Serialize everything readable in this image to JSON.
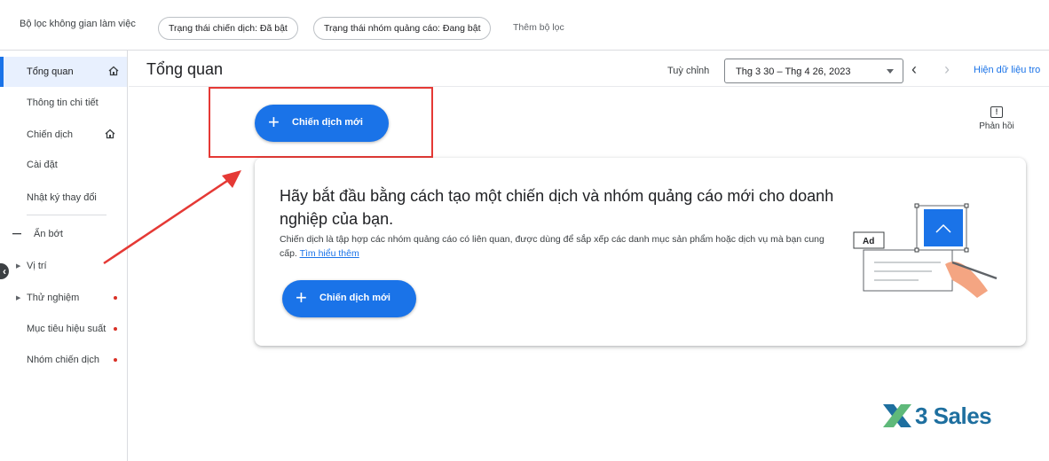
{
  "filterbar": {
    "label": "Bộ lọc không gian làm việc",
    "chips": [
      "Trạng thái chiến dịch: Đã bật",
      "Trạng thái nhóm quảng cáo: Đang bật"
    ],
    "add_filter": "Thêm bộ lọc"
  },
  "sidebar": {
    "items": [
      {
        "label": "Tổng quan",
        "icon": "home-icon",
        "active": true
      },
      {
        "label": "Thông tin chi tiết"
      },
      {
        "label": "Chiến dịch",
        "icon": "home-icon"
      },
      {
        "label": "Cài đặt"
      },
      {
        "label": "Nhật ký thay đổi"
      },
      {
        "label": "Ẩn bớt",
        "icon": "minus-icon"
      },
      {
        "label": "Vị trí",
        "icon": "triangle-right-icon"
      },
      {
        "label": "Thử nghiệm",
        "icon": "triangle-right-icon",
        "dot": true
      },
      {
        "label": "Mục tiêu hiệu suất",
        "dot": true
      },
      {
        "label": "Nhóm chiến dịch",
        "dot": true
      }
    ]
  },
  "header": {
    "title": "Tổng quan",
    "custom_label": "Tuỳ chỉnh",
    "date_range": "Thg 3 30 – Thg 4 26, 2023",
    "show_data": "Hiện dữ liệu tro"
  },
  "new_campaign_label": "Chiến dịch mới",
  "feedback_label": "Phản hồi",
  "card": {
    "title": "Hãy bắt đầu bằng cách tạo một chiến dịch và nhóm quảng cáo mới cho doanh nghiệp của bạn.",
    "desc": "Chiến dịch là tập hợp các nhóm quảng cáo có liên quan, được dùng để sắp xếp các danh mục sản phẩm hoặc dịch vụ mà bạn cung cấp.",
    "learn_more": "Tìm hiểu thêm",
    "ad_tag": "Ad"
  },
  "logo": {
    "text": "3 Sales"
  },
  "colors": {
    "accent": "#1a73e8",
    "highlight": "#e53935",
    "status_dot": "#d93025"
  }
}
